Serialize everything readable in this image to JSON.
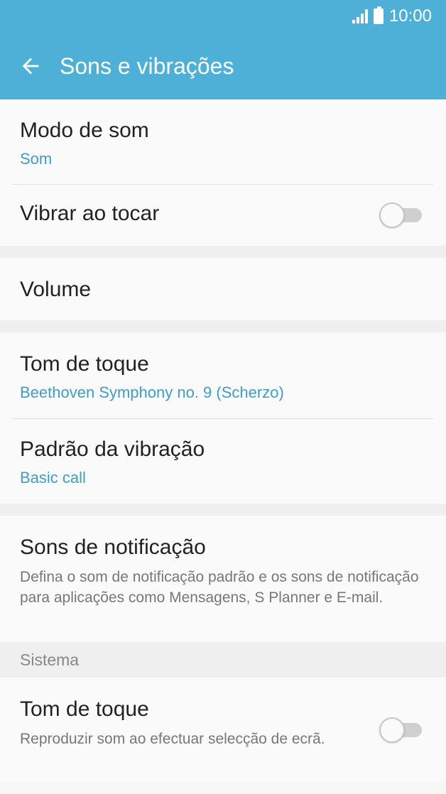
{
  "status_bar": {
    "time": "10:00"
  },
  "app_bar": {
    "title": "Sons e vibrações"
  },
  "items": {
    "modo_de_som": {
      "title": "Modo de som",
      "value": "Som"
    },
    "vibrar_ao_tocar": {
      "title": "Vibrar ao tocar",
      "enabled": false
    },
    "volume": {
      "title": "Volume"
    },
    "tom_de_toque": {
      "title": "Tom de toque",
      "value": "Beethoven Symphony no. 9 (Scherzo)"
    },
    "padrao_da_vibracao": {
      "title": "Padrão da vibração",
      "value": "Basic call"
    },
    "sons_de_notificacao": {
      "title": "Sons de notificação",
      "description": "Defina o som de notificação padrão e os sons de notificação para aplicações como Mensagens, S Planner e E-mail."
    }
  },
  "system": {
    "header": "Sistema",
    "tom_de_toque": {
      "title": "Tom de toque",
      "description": "Reproduzir som ao efectuar selecção de ecrã.",
      "enabled": false
    }
  },
  "colors": {
    "accent": "#4eb0d7",
    "value_text": "#3d9ec7",
    "background": "#f6f6f6"
  },
  "icons": [
    "signal-icon",
    "battery-icon",
    "back-arrow-icon"
  ]
}
